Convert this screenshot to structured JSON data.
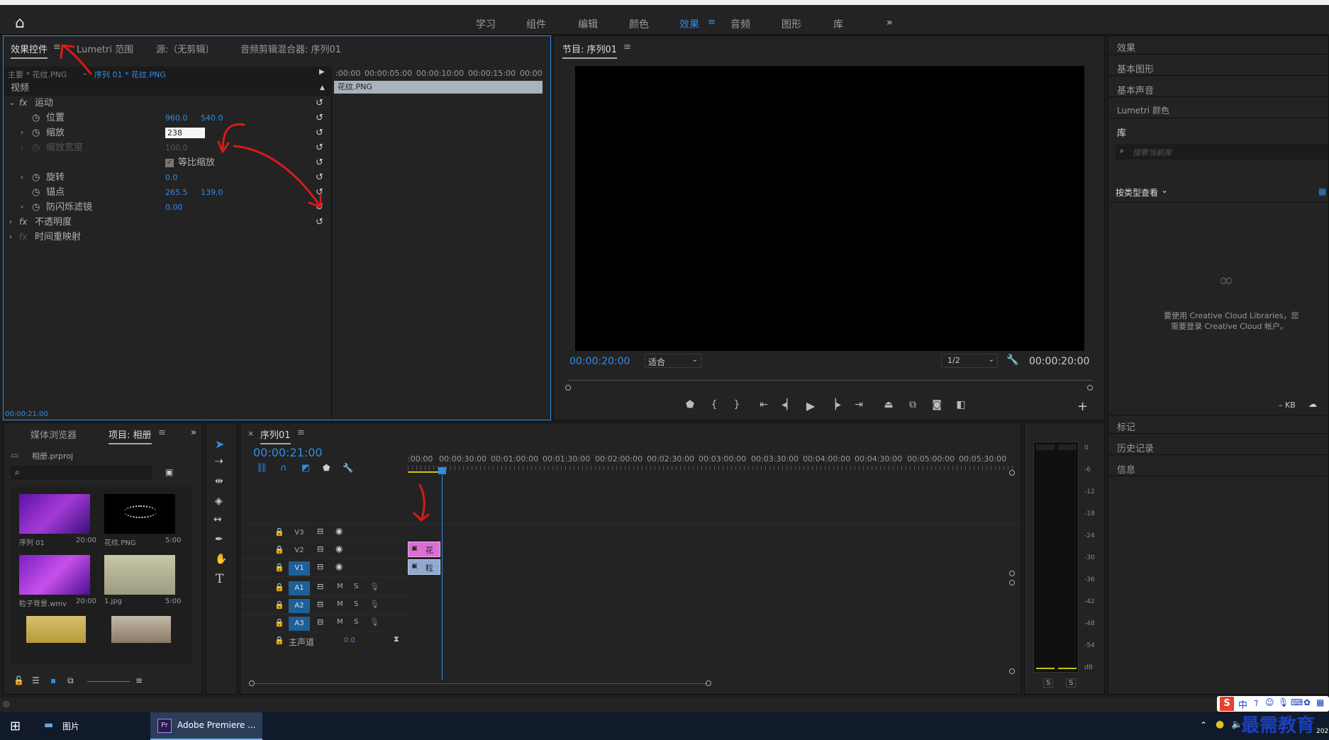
{
  "workspaces": {
    "items": [
      "学习",
      "组件",
      "编辑",
      "颜色",
      "效果",
      "音频",
      "图形",
      "库"
    ],
    "active": "效果",
    "more": "»"
  },
  "effect_controls": {
    "tabs": [
      "效果控件",
      "Lumetri 范围",
      "源:（无剪辑）",
      "音频剪辑混合器: 序列01"
    ],
    "tab_menu": "≡",
    "master_label": "主要 * 花纹.PNG",
    "clip_label": "序列 01 * 花纹.PNG",
    "section_video": "视频",
    "motion": "运动",
    "position_label": "位置",
    "position_x": "960.0",
    "position_y": "540.0",
    "scale_label": "缩放",
    "scale_value": "238",
    "scale_width_label": "缩放宽度",
    "scale_width_value": "100.0",
    "uniform_scale_label": "等比缩放",
    "rotation_label": "旋转",
    "rotation_value": "0.0",
    "anchor_label": "锚点",
    "anchor_x": "265.5",
    "anchor_y": "139.0",
    "antiflicker_label": "防闪烁滤镜",
    "antiflicker_value": "0.00",
    "opacity_label": "不透明度",
    "time_remap_label": "时间重映射",
    "timecode": "00:00:21:00",
    "timeline_ticks": [
      ":00:00",
      "00:00:05:00",
      "00:00:10:00",
      "00:00:15:00",
      "00:00"
    ],
    "clip_name": "花纹.PNG"
  },
  "program_monitor": {
    "title": "节目: 序列01",
    "menu": "≡",
    "timecode_left": "00:00:20:00",
    "fit": "适合",
    "resolution": "1/2",
    "timecode_right": "00:00:20:00"
  },
  "right_panel": {
    "items": [
      "效果",
      "基本图形",
      "基本声音",
      "Lumetri 颜色",
      "库"
    ],
    "search_placeholder": "搜索当前库",
    "view_by": "按类型查看",
    "cc_message_1": "要使用 Creative Cloud Libraries，您",
    "cc_message_2": "需要登录 Creative Cloud 帐户。",
    "kb": "– KB",
    "lower_items": [
      "标记",
      "历史记录",
      "信息"
    ]
  },
  "project": {
    "tabs": [
      "媒体浏览器",
      "项目: 相册"
    ],
    "more": "»",
    "file": "相册.prproj",
    "items": [
      {
        "name": "序列 01",
        "duration": "20:00"
      },
      {
        "name": "花纹.PNG",
        "duration": "5:00"
      },
      {
        "name": "粒子背景.wmv",
        "duration": "20:00"
      },
      {
        "name": "1.jpg",
        "duration": "5:00"
      }
    ]
  },
  "timeline": {
    "tab": "序列01",
    "timecode": "00:00:21:00",
    "ruler": [
      ":00:00",
      "00:00:30:00",
      "00:01:00:00",
      "00:01:30:00",
      "00:02:00:00",
      "00:02:30:00",
      "00:03:00:00",
      "00:03:30:00",
      "00:04:00:00",
      "00:04:30:00",
      "00:05:00:00",
      "00:05:30:00"
    ],
    "video_tracks": [
      "V3",
      "V2",
      "V1"
    ],
    "audio_tracks": [
      "A1",
      "A2",
      "A3"
    ],
    "mute": "M",
    "solo": "S",
    "master": "主声道",
    "master_value": "0.0",
    "clip_v2": "花",
    "clip_v1": "粒"
  },
  "audio_meter": {
    "scale": [
      "0",
      "-6",
      "-12",
      "-18",
      "-24",
      "-30",
      "-36",
      "-42",
      "-48",
      "-54",
      "dB"
    ],
    "solo_left": "S",
    "solo_right": "S"
  },
  "taskbar": {
    "items": [
      "图片",
      "Adobe Premiere ..."
    ],
    "ime": "中",
    "watermark": "最需教育",
    "year": "202"
  }
}
